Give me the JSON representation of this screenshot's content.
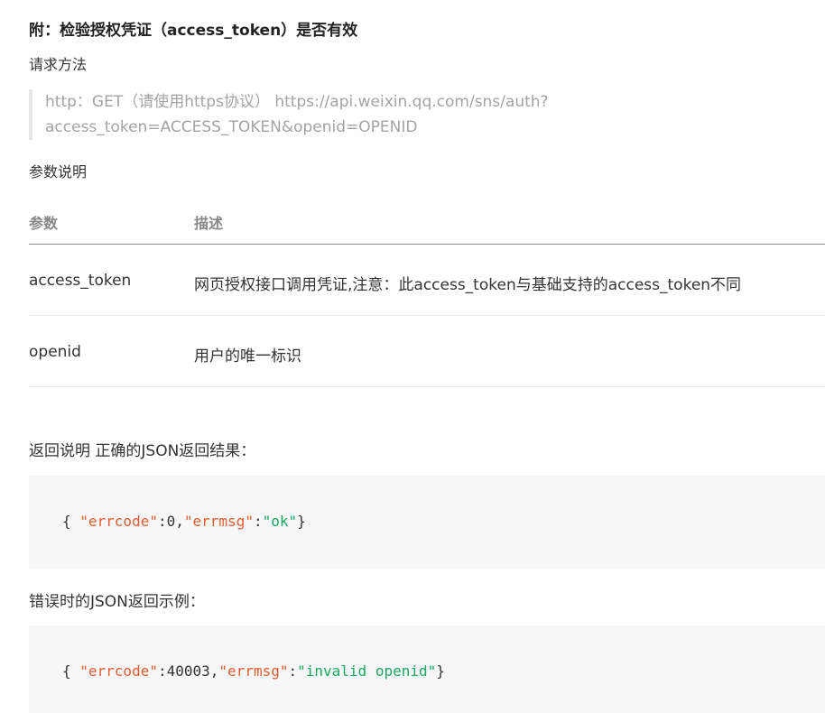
{
  "section": {
    "title": "附：检验授权凭证（access_token）是否有效"
  },
  "request": {
    "label": "请求方法",
    "url_line1": "http：GET（请使用https协议） https://api.weixin.qq.com/sns/auth?",
    "url_line2": "access_token=ACCESS_TOKEN&openid=OPENID"
  },
  "params": {
    "label": "参数说明",
    "headers": [
      "参数",
      "描述"
    ],
    "rows": [
      {
        "name": "access_token",
        "desc": "网页授权接口调用凭证,注意：此access_token与基础支持的access_token不同"
      },
      {
        "name": "openid",
        "desc": "用户的唯一标识"
      }
    ]
  },
  "response_ok": {
    "label": "返回说明 正确的JSON返回结果：",
    "open": "{ ",
    "key1": "\"errcode\"",
    "colon1": ":",
    "val1": "0",
    "comma": ",",
    "key2": "\"errmsg\"",
    "colon2": ":",
    "val2": "\"ok\"",
    "close": "}"
  },
  "response_err": {
    "label": "错误时的JSON返回示例：",
    "open": "{ ",
    "key1": "\"errcode\"",
    "colon1": ":",
    "val1": "40003",
    "comma": ",",
    "key2": "\"errmsg\"",
    "colon2": ":",
    "val2": "\"invalid openid\"",
    "close": "}"
  }
}
